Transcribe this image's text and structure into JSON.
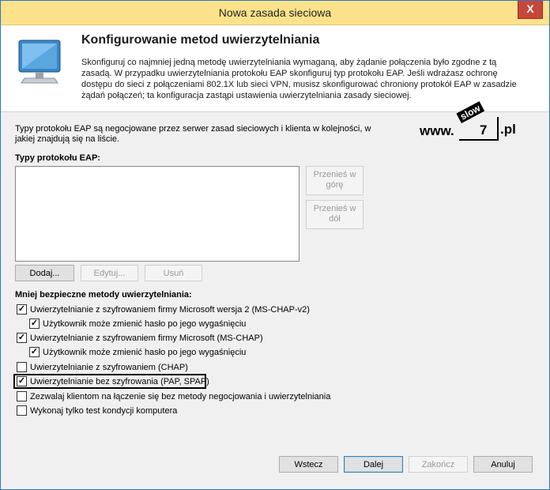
{
  "window": {
    "title": "Nowa zasada sieciowa",
    "close_glyph": "X"
  },
  "header": {
    "title": "Konfigurowanie metod uwierzytelniania",
    "description": "Skonfiguruj co najmniej jedną metodę uwierzytelniania wymaganą, aby żądanie połączenia było zgodne z tą zasadą. W przypadku uwierzytelniania protokołu EAP skonfiguruj typ protokołu EAP. Jeśli wdrażasz ochronę dostępu do sieci z połączeniami 802.1X lub sieci VPN, musisz skonfigurować chroniony protokół EAP w zasadzie żądań połączeń; ta konfiguracja zastąpi ustawienia uwierzytelniania zasady sieciowej.",
    "icon": "monitor-icon"
  },
  "intro": "Typy protokołu EAP są negocjowane przez serwer zasad sieciowych i klienta w kolejności, w jakiej znajdują się na liście.",
  "logo": {
    "www": "www.",
    "slow": "slow",
    "seven": "7",
    "pl": ".pl"
  },
  "eap": {
    "label": "Typy protokołu EAP:",
    "items": [],
    "move_up": "Przenieś w górę",
    "move_down": "Przenieś w dół",
    "add": "Dodaj...",
    "edit": "Edytuj...",
    "remove": "Usuń"
  },
  "less_secure": {
    "label": "Mniej bezpieczne metody uwierzytelniania:",
    "options": [
      {
        "text": "Uwierzytelnianie z szyfrowaniem firmy Microsoft wersja 2 (MS-CHAP-v2)",
        "checked": true
      },
      {
        "text": "Użytkownik może zmienić hasło po jego wygaśnięciu",
        "checked": true
      },
      {
        "text": "Uwierzytelnianie z szyfrowaniem firmy Microsoft (MS-CHAP)",
        "checked": true
      },
      {
        "text": "Użytkownik może zmienić hasło po jego wygaśnięciu",
        "checked": true
      },
      {
        "text": "Uwierzytelnianie z szyfrowaniem (CHAP)",
        "checked": false
      },
      {
        "text": "Uwierzytelnianie bez szyfrowania (PAP, SPAP)",
        "checked": true
      },
      {
        "text": "Zezwalaj klientom na łączenie się bez metody negocjowania i uwierzytelniania",
        "checked": false
      },
      {
        "text": "Wykonaj tylko test kondycji komputera",
        "checked": false
      }
    ]
  },
  "footer": {
    "back": "Wstecz",
    "next": "Dalej",
    "finish": "Zakończ",
    "cancel": "Anuluj"
  },
  "colors": {
    "titlebar": "#fde28b",
    "close": "#c7463a",
    "border": "#2b78c5"
  }
}
